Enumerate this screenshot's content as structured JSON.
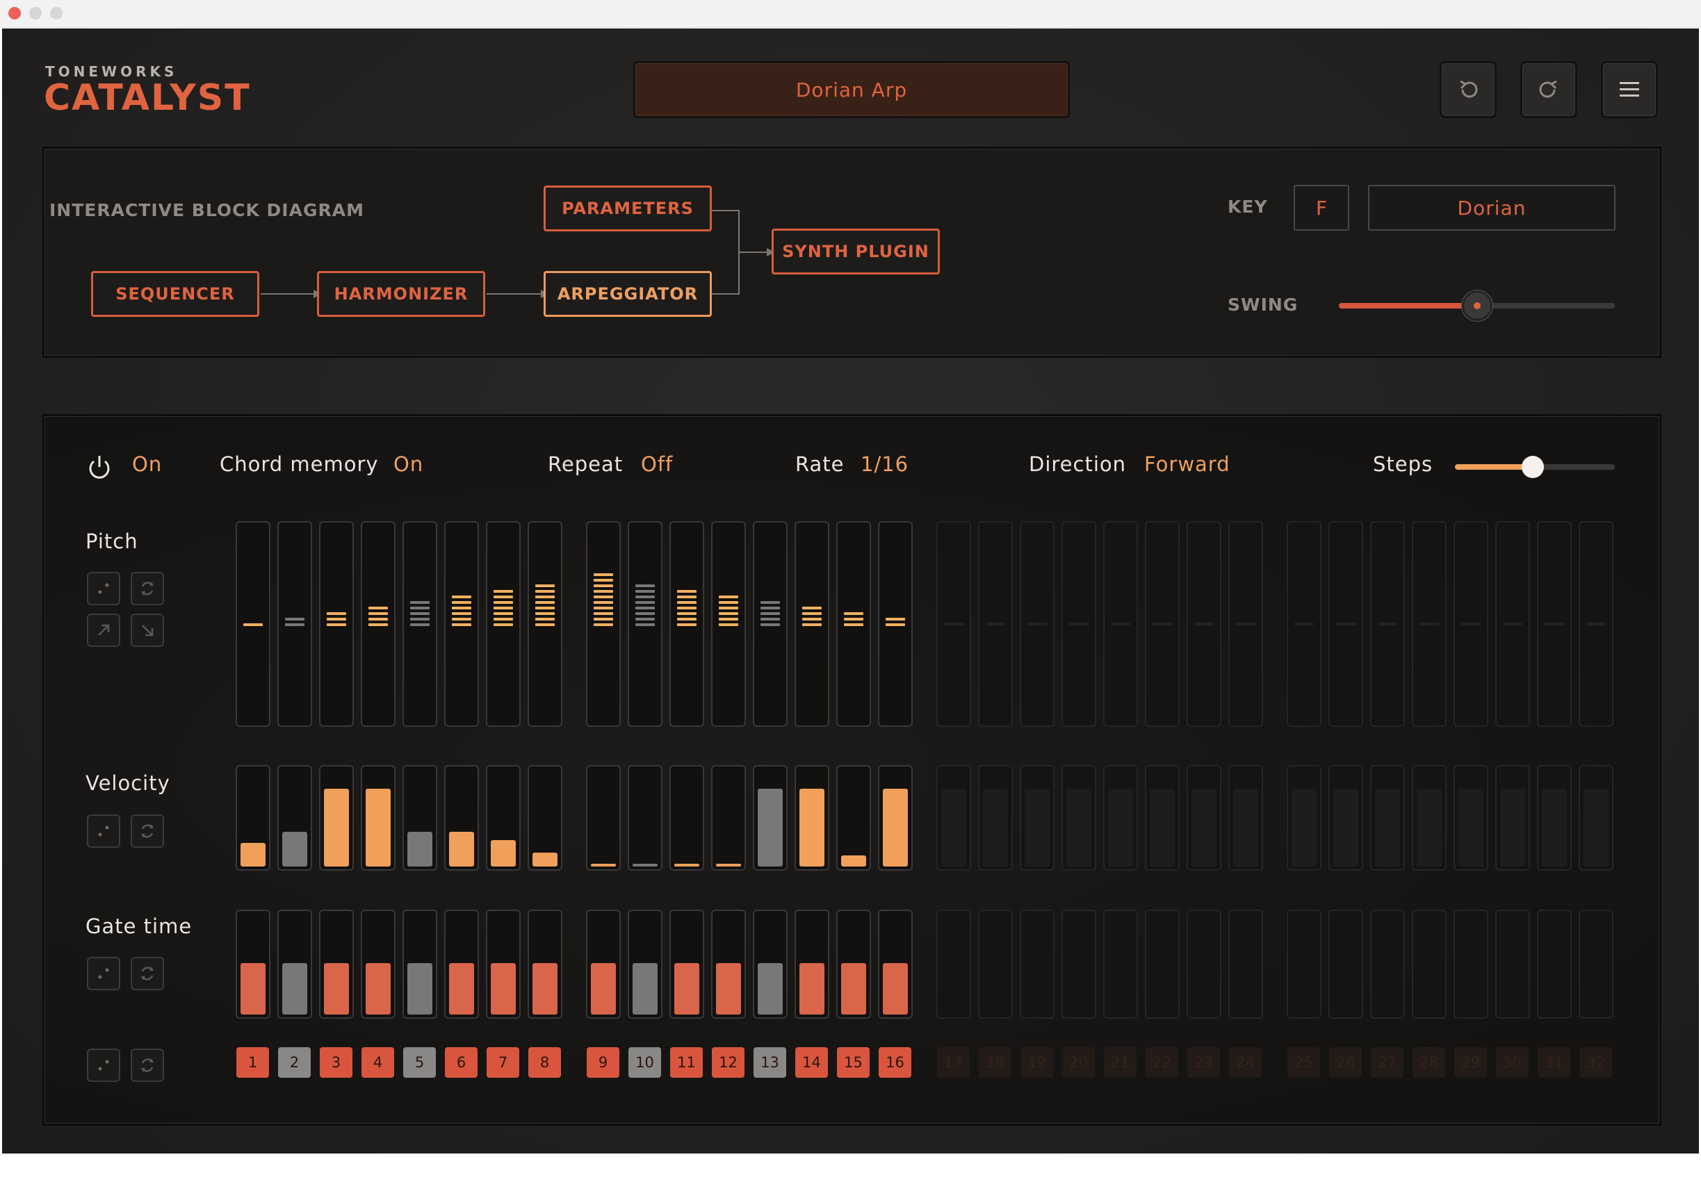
{
  "header": {
    "brand_top": "TONEWORKS",
    "brand_main": "CATALYST",
    "preset_name": "Dorian Arp",
    "undo_icon": "undo-icon",
    "redo_icon": "redo-icon",
    "menu_icon": "hamburger-menu-icon"
  },
  "diagram": {
    "title": "INTERACTIVE BLOCK DIAGRAM",
    "blocks": {
      "sequencer": "SEQUENCER",
      "harmonizer": "HARMONIZER",
      "arpeggiator": "ARPEGGIATOR",
      "parameters": "PARAMETERS",
      "synth": "SYNTH PLUGIN"
    },
    "key_label": "KEY",
    "key_value": "F",
    "scale_value": "Dorian",
    "swing_label": "SWING",
    "swing_value": 0.5
  },
  "controls": {
    "power_value": "On",
    "chord_memory_label": "Chord memory",
    "chord_memory_value": "On",
    "repeat_label": "Repeat",
    "repeat_value": "Off",
    "rate_label": "Rate",
    "rate_value": "1/16",
    "direction_label": "Direction",
    "direction_value": "Forward",
    "steps_label": "Steps",
    "steps_value": 0.5
  },
  "rows": {
    "pitch_label": "Pitch",
    "velocity_label": "Velocity",
    "gate_label": "Gate time"
  },
  "steps": {
    "numbers": [
      "1",
      "2",
      "3",
      "4",
      "5",
      "6",
      "7",
      "8",
      "9",
      "10",
      "11",
      "12",
      "13",
      "14",
      "15",
      "16",
      "17",
      "18",
      "19",
      "20",
      "21",
      "22",
      "23",
      "24",
      "25",
      "26",
      "27",
      "28",
      "29",
      "30",
      "31",
      "32"
    ],
    "active_count": 16,
    "muted": [
      2,
      5,
      10,
      13
    ],
    "pitch_levels": [
      1,
      2,
      3,
      4,
      5,
      6,
      7,
      8,
      10,
      8,
      7,
      6,
      5,
      4,
      3,
      2
    ],
    "velocity": [
      0.3,
      0.45,
      1.0,
      1.0,
      0.45,
      0.45,
      0.34,
      0.18,
      0.04,
      0.03,
      0.03,
      0.03,
      1.0,
      1.0,
      0.14,
      1.0
    ],
    "gate": [
      0.5,
      0.5,
      0.5,
      0.5,
      0.5,
      0.5,
      0.5,
      0.5,
      0.5,
      0.5,
      0.5,
      0.5,
      0.5,
      0.5,
      0.5,
      0.5
    ]
  },
  "colors": {
    "accent": "#e0643f",
    "active_orange": "#f0a05a",
    "muted_gray": "#7a7877",
    "gate_red": "#d9654a",
    "number_red": "#d9553d"
  }
}
